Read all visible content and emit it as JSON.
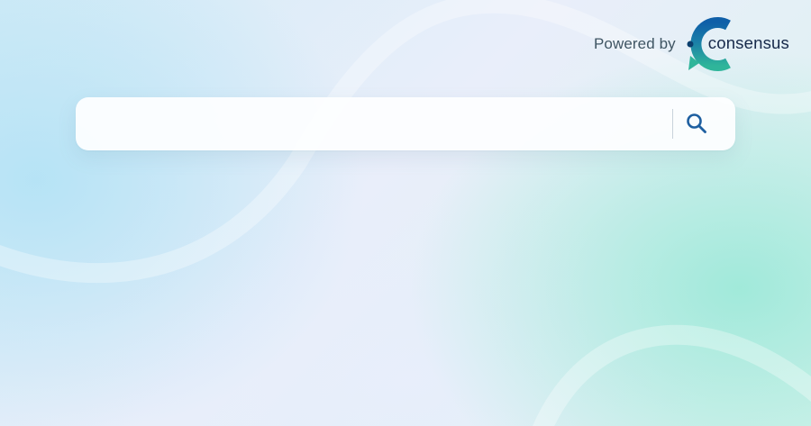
{
  "header": {
    "powered_by": "Powered by",
    "brand_name": "consensus",
    "brand_icon": "consensus-logo-icon",
    "brand_colors": {
      "dark_blue": "#0f5fa8",
      "teal": "#2fb59a",
      "text": "#16294a"
    }
  },
  "search": {
    "value": "",
    "placeholder": "",
    "button_icon": "search-icon",
    "icon_color": "#1e5fa0"
  }
}
